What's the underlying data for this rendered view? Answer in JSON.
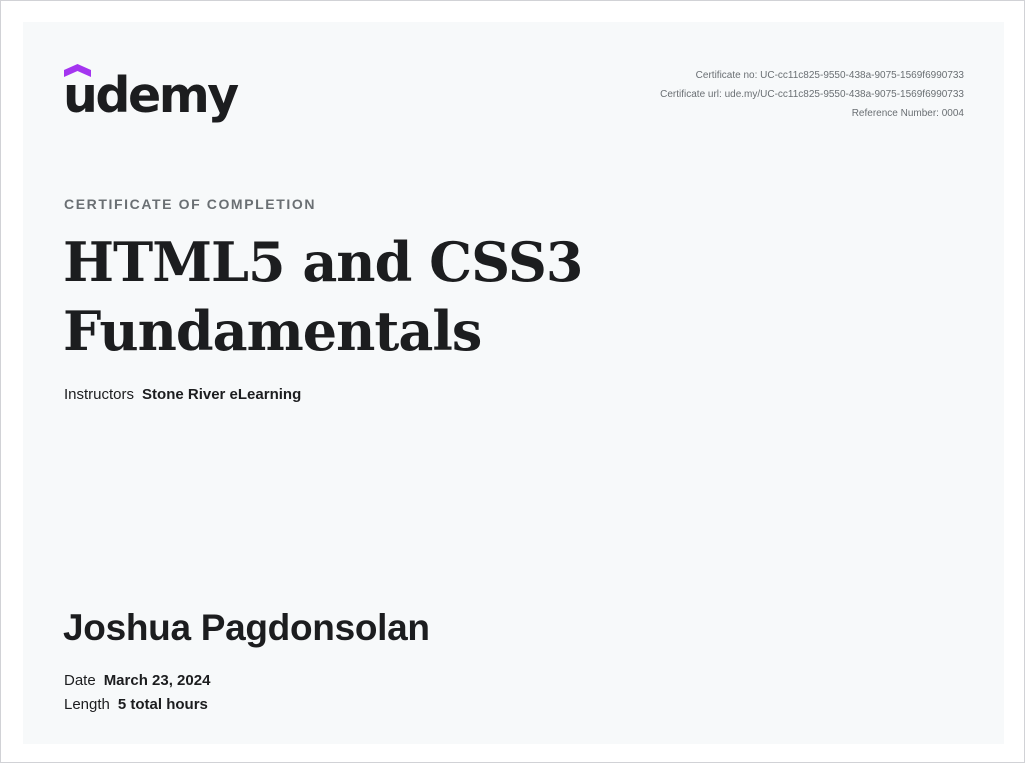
{
  "brand": {
    "name": "udemy",
    "accent_color": "#a435f0",
    "text_color": "#1c1d1f"
  },
  "meta": {
    "certificate_no": "Certificate no: UC-cc11c825-9550-438a-9075-1569f6990733",
    "certificate_url": "Certificate url: ude.my/UC-cc11c825-9550-438a-9075-1569f6990733",
    "reference_number": "Reference Number: 0004"
  },
  "certificate": {
    "kicker": "CERTIFICATE OF COMPLETION",
    "course_title_line1": "HTML5 and CSS3",
    "course_title_line2": "Fundamentals",
    "instructors_label": "Instructors",
    "instructors_value": "Stone River eLearning",
    "student_name": "Joshua Pagdonsolan",
    "date_label": "Date",
    "date_value": "March 23, 2024",
    "length_label": "Length",
    "length_value": "5 total hours"
  }
}
